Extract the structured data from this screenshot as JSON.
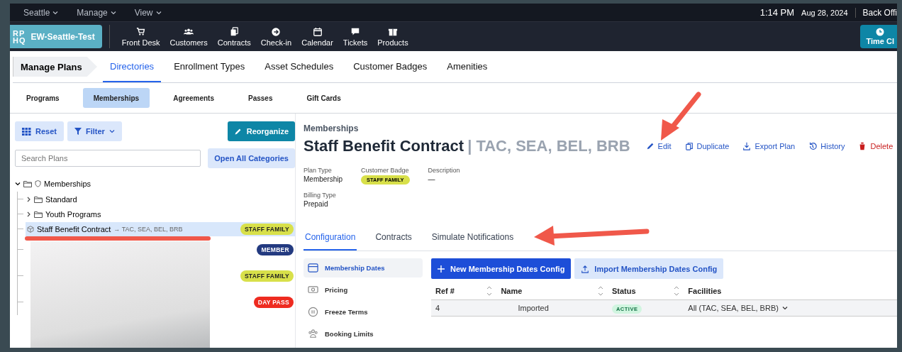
{
  "top_bar": {
    "menus": [
      "Seattle",
      "Manage",
      "View"
    ],
    "time": "1:14 PM",
    "date": "Aug 28, 2024",
    "account": "Back Offi"
  },
  "nav": {
    "logo": [
      "RP",
      "HQ"
    ],
    "site": "EW-Seattle-Test",
    "items": [
      "Front Desk",
      "Customers",
      "Contracts",
      "Check-in",
      "Calendar",
      "Tickets",
      "Products"
    ],
    "time_clock": "Time Cl"
  },
  "breadcrumb": "Manage Plans",
  "tabs": [
    {
      "label": "Directories",
      "selected": true
    },
    {
      "label": "Enrollment Types",
      "selected": false
    },
    {
      "label": "Asset Schedules",
      "selected": false
    },
    {
      "label": "Customer Badges",
      "selected": false
    },
    {
      "label": "Amenities",
      "selected": false
    }
  ],
  "subtabs": [
    {
      "label": "Programs",
      "selected": false
    },
    {
      "label": "Memberships",
      "selected": true
    },
    {
      "label": "Agreements",
      "selected": false
    },
    {
      "label": "Passes",
      "selected": false
    },
    {
      "label": "Gift Cards",
      "selected": false
    }
  ],
  "left": {
    "reset": "Reset",
    "filter": "Filter",
    "reorganize": "Reorganize",
    "search": {
      "placeholder": "Search Plans"
    },
    "open_all": "Open All Categories",
    "tree": {
      "label": "Memberships",
      "expanded": true,
      "children": [
        {
          "kind": "folder",
          "label": "Standard",
          "expanded": false,
          "selected": false
        },
        {
          "kind": "folder",
          "label": "Youth Programs",
          "expanded": false,
          "selected": false
        },
        {
          "kind": "plan",
          "label": "Staff Benefit Contract",
          "facilities": "→ TAC, SEA, BEL, BRB",
          "selected": true,
          "badge": {
            "label": "STAFF FAMILY",
            "color": "#d8e04a"
          }
        },
        {
          "kind": "hidden",
          "selected": false,
          "badge": {
            "label": "MEMBER",
            "color": "#233a80"
          }
        },
        {
          "kind": "hidden",
          "selected": false,
          "badge": {
            "label": "STAFF FAMILY",
            "color": "#d8e04a"
          }
        },
        {
          "kind": "hidden",
          "selected": false,
          "badge": {
            "label": "DAY PASS",
            "color": "#ee2b20"
          }
        }
      ]
    }
  },
  "detail": {
    "category": "Memberships",
    "title": "Staff Benefit Contract",
    "title_suffix": "| TAC, SEA, BEL, BRB",
    "actions": [
      {
        "label": "Edit",
        "kind": "primary"
      },
      {
        "label": "Duplicate",
        "kind": "primary"
      },
      {
        "label": "Export Plan",
        "kind": "primary"
      },
      {
        "label": "History",
        "kind": "primary"
      },
      {
        "label": "Delete",
        "kind": "danger"
      }
    ],
    "meta": [
      {
        "label": "Plan Type",
        "value": "Membership"
      },
      {
        "label": "Customer Badge",
        "badge": {
          "label": "STAFF FAMILY",
          "color": "#d8e04a"
        }
      },
      {
        "label": "Description",
        "value": "—"
      },
      {
        "label": "Billing Type",
        "value": "Prepaid"
      }
    ],
    "tabs": [
      {
        "label": "Configuration",
        "selected": true
      },
      {
        "label": "Contracts",
        "selected": false
      },
      {
        "label": "Simulate Notifications",
        "selected": false
      }
    ],
    "side_menu": [
      {
        "label": "Membership Dates",
        "selected": true
      },
      {
        "label": "Pricing",
        "selected": false
      },
      {
        "label": "Freeze Terms",
        "selected": false
      },
      {
        "label": "Booking Limits",
        "selected": false
      }
    ],
    "new_button": "New Membership Dates Config",
    "import_button": "Import Membership Dates Config",
    "table": {
      "columns": [
        "Ref #",
        "Name",
        "Status",
        "Facilities"
      ],
      "rows": [
        {
          "ref": "4",
          "name": "Imported",
          "status": "ACTIVE",
          "facilities": "All (TAC, SEA, BEL, BRB)"
        }
      ]
    }
  }
}
